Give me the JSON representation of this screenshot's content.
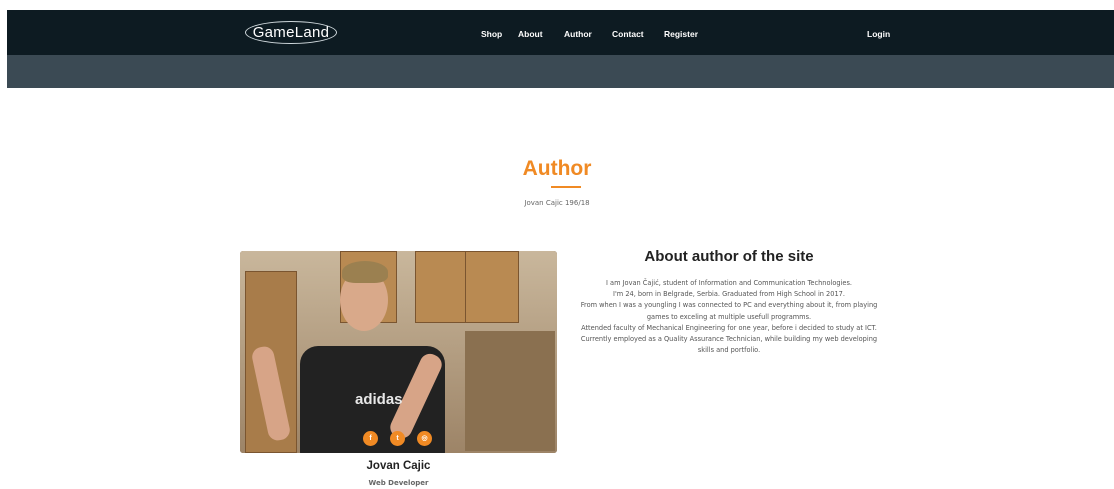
{
  "header": {
    "logo": "GameLand",
    "nav": [
      {
        "label": "Shop"
      },
      {
        "label": "About"
      },
      {
        "label": "Author"
      },
      {
        "label": "Contact"
      },
      {
        "label": "Register"
      }
    ],
    "login": "Login"
  },
  "section": {
    "title": "Author",
    "subtitle": "Jovan Cajic 196/18"
  },
  "profile": {
    "shirt_print": "adidas",
    "social": [
      {
        "icon": "facebook-icon",
        "glyph": "f"
      },
      {
        "icon": "twitter-icon",
        "glyph": "t"
      },
      {
        "icon": "instagram-icon",
        "glyph": "◎"
      }
    ],
    "name": "Jovan Cajic",
    "role": "Web Developer"
  },
  "about": {
    "title": "About author of the site",
    "lines": [
      "I am Jovan Čajić, student of Information and Communication Technologies.",
      "I'm 24, born in Belgrade, Serbia. Graduated from High School in 2017.",
      "From when I was a youngling I was connected to PC and everything about it, from playing games to exceling at multiple usefull programms.",
      "Attended faculty of Mechanical Engineering for one year, before i decided to study at ICT.",
      "Currently employed as a Quality Assurance Technician, while building my web developing skills and portfolio."
    ]
  },
  "colors": {
    "accent": "#f08a24",
    "topbar": "#0d1b22",
    "subbar": "#3b4a54"
  }
}
